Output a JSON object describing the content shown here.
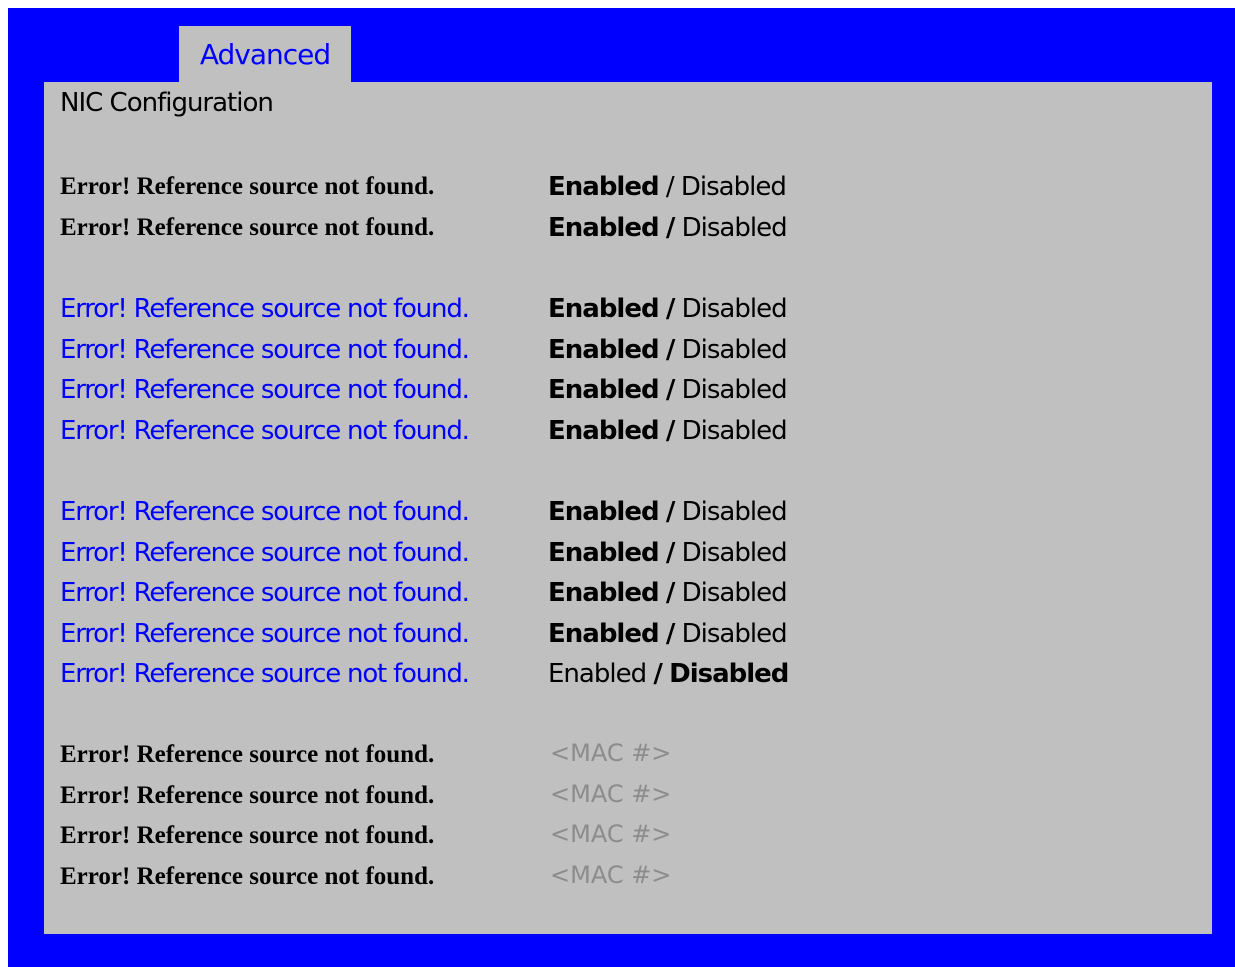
{
  "tab": {
    "label": "Advanced"
  },
  "page": {
    "title": "NIC Configuration"
  },
  "options": {
    "enabled": "Enabled",
    "separator": "/",
    "disabled": "Disabled"
  },
  "group1": [
    {
      "label": "Error! Reference source not found.",
      "selected": "Enabled"
    },
    {
      "label": "Error! Reference source not found.",
      "selected": "Enabled"
    }
  ],
  "group2": [
    {
      "label": "Error! Reference source not found.",
      "selected": "Enabled"
    },
    {
      "label": "Error! Reference source not found.",
      "selected": "Enabled"
    },
    {
      "label": "Error! Reference source not found.",
      "selected": "Enabled"
    },
    {
      "label": "Error! Reference source not found.",
      "selected": "Enabled"
    }
  ],
  "group3": [
    {
      "label": "Error! Reference source not found.",
      "selected": "Enabled"
    },
    {
      "label": "Error! Reference source not found.",
      "selected": "Enabled"
    },
    {
      "label": "Error! Reference source not found.",
      "selected": "Enabled"
    },
    {
      "label": "Error! Reference source not found.",
      "selected": "Enabled"
    },
    {
      "label": "Error! Reference source not found.",
      "selected": "Disabled"
    }
  ],
  "group4": [
    {
      "label": "Error! Reference source not found.",
      "value": "<MAC #>"
    },
    {
      "label": "Error! Reference source not found.",
      "value": "<MAC #>"
    },
    {
      "label": "Error! Reference source not found.",
      "value": "<MAC #>"
    },
    {
      "label": "Error! Reference source not found.",
      "value": "<MAC #>"
    }
  ],
  "colors": {
    "frame": "#0000ff",
    "panel": "#c0c0c0",
    "link_text": "#0000ff",
    "text": "#000000",
    "mac_text": "#8c8c8c"
  }
}
